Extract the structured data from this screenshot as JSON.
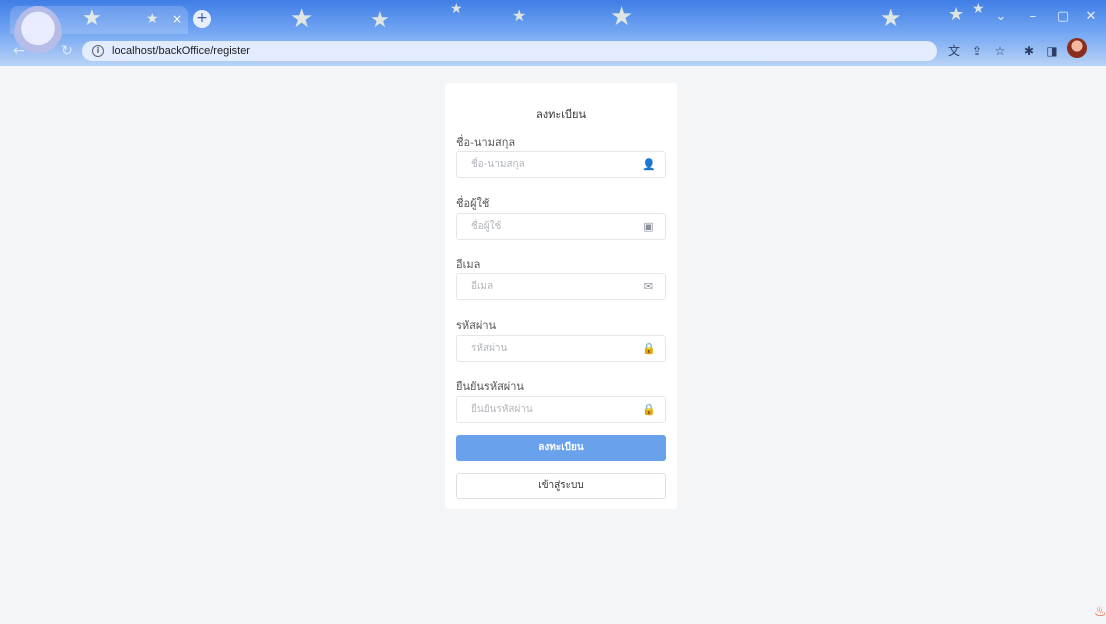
{
  "browser": {
    "url": "localhost/backOffice/register",
    "tab_close_glyph": "×",
    "new_tab_glyph": "+",
    "window_controls": [
      "⌄",
      "–",
      "▢",
      "✕"
    ]
  },
  "form": {
    "title": "ลงทะเบียน",
    "fields": [
      {
        "label": "ชื่อ-นามสกุล",
        "placeholder": "ชื่อ-นามสกุล",
        "icon": "user-icon",
        "glyph": "👤"
      },
      {
        "label": "ชื่อผู้ใช้",
        "placeholder": "ชื่อผู้ใช้",
        "icon": "id-card-icon",
        "glyph": "▣"
      },
      {
        "label": "อีเมล",
        "placeholder": "อีเมล",
        "icon": "envelope-icon",
        "glyph": "✉"
      },
      {
        "label": "รหัสผ่าน",
        "placeholder": "รหัสผ่าน",
        "icon": "lock-icon",
        "glyph": "🔒"
      },
      {
        "label": "ยืนยันรหัสผ่าน",
        "placeholder": "ยืนยันรหัสผ่าน",
        "icon": "lock-icon",
        "glyph": "🔒"
      }
    ],
    "register_button": "ลงทะเบียน",
    "login_button": "เข้าสู่ระบบ"
  },
  "colors": {
    "page_bg": "#f4f5f7",
    "card_bg": "#ffffff",
    "primary_button": "#6aa1ec",
    "theme_blue": "#3f7ee6"
  }
}
